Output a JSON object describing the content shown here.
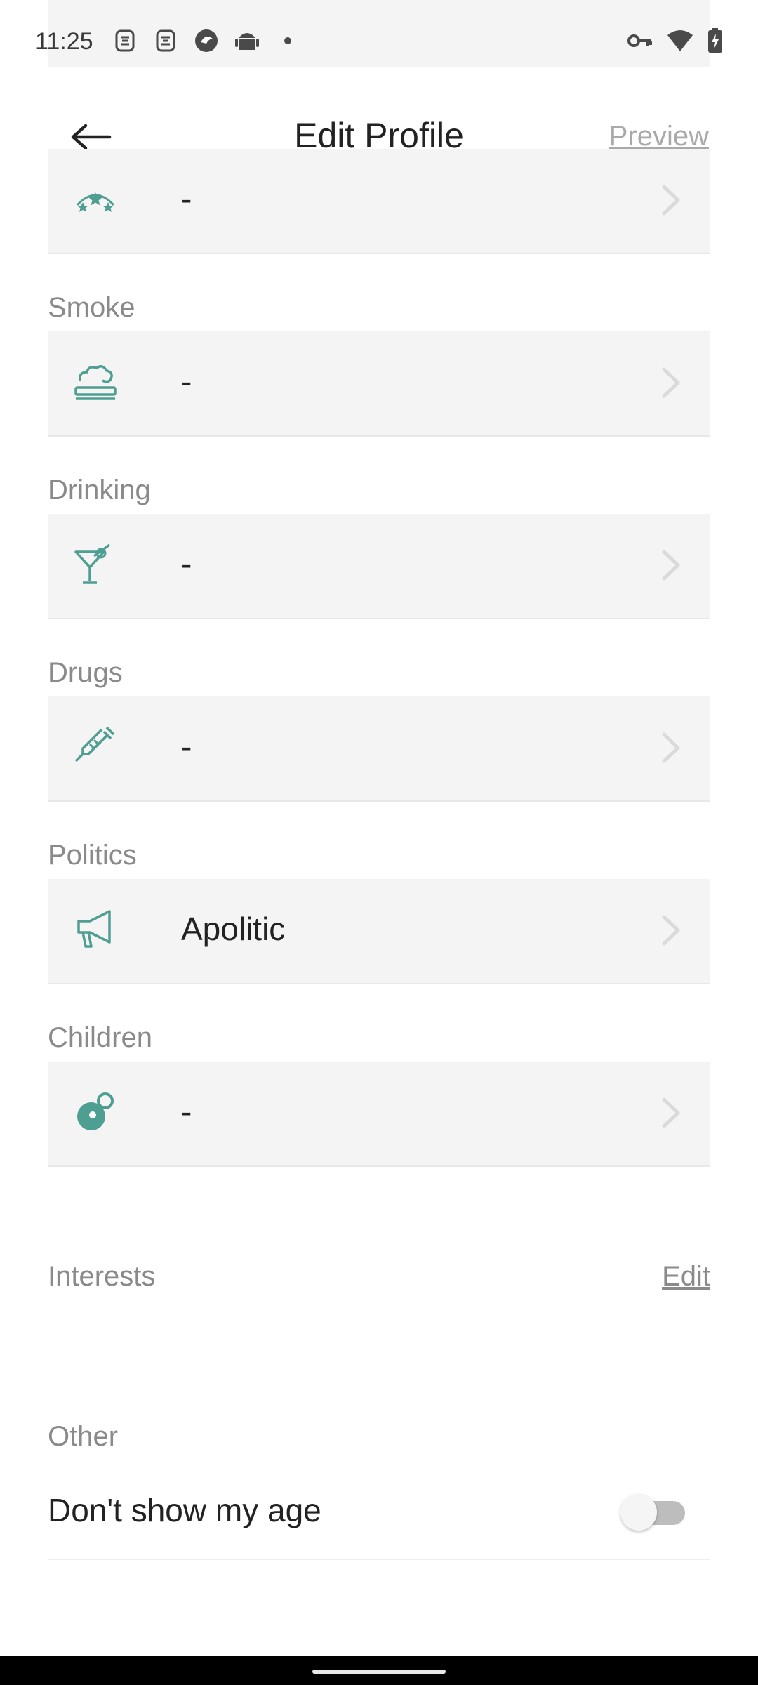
{
  "status_bar": {
    "time": "11:25",
    "left_icons": [
      "notification-s-icon",
      "notification-s-icon",
      "browser-icon",
      "android-icon",
      "dot-icon"
    ],
    "right_icons": [
      "vpn-key-icon",
      "wifi-icon",
      "battery-charging-icon"
    ]
  },
  "header": {
    "title": "Edit Profile",
    "preview_label": "Preview",
    "back_icon": "arrow-left-icon"
  },
  "colors": {
    "accent": "#4f9e92",
    "row_bg": "#f4f4f4",
    "label": "#8a8a8a"
  },
  "fields": [
    {
      "label": "",
      "value": "-",
      "icon": "zodiac-stars-icon"
    },
    {
      "label": "Smoke",
      "value": "-",
      "icon": "cigarette-icon"
    },
    {
      "label": "Drinking",
      "value": "-",
      "icon": "cocktail-icon"
    },
    {
      "label": "Drugs",
      "value": "-",
      "icon": "syringe-icon"
    },
    {
      "label": "Politics",
      "value": "Apolitic",
      "icon": "megaphone-icon"
    },
    {
      "label": "Children",
      "value": "-",
      "icon": "pacifier-icon"
    }
  ],
  "interests": {
    "label": "Interests",
    "edit_label": "Edit"
  },
  "other": {
    "label": "Other",
    "toggle_label": "Don't show my age",
    "toggle_on": false
  }
}
